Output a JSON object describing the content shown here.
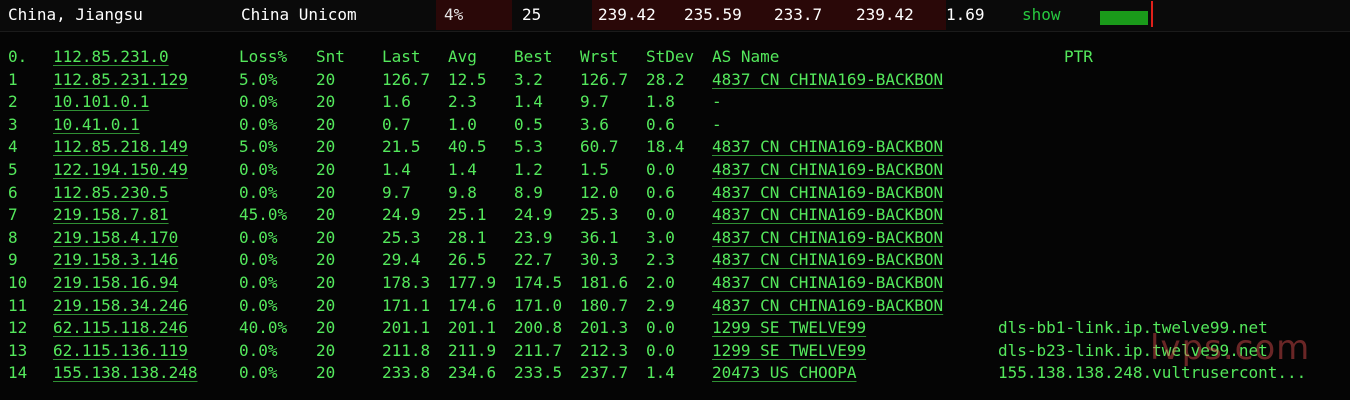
{
  "top": {
    "location": "China, Jiangsu",
    "isp": "China Unicom",
    "loss": "4%",
    "snt": "25",
    "last": "239.42",
    "avg": "235.59",
    "best": "233.7",
    "wrst": "239.42",
    "stdev": "1.69",
    "show_label": "show",
    "bar_fill_fraction": 0.78,
    "bar_color": "#1a9a1a",
    "marker_color": "#e0201a"
  },
  "columns": {
    "hop": "0.",
    "host": "112.85.231.0",
    "loss": "Loss%",
    "snt": "Snt",
    "last": "Last",
    "avg": "Avg",
    "best": "Best",
    "wrst": "Wrst",
    "stdev": "StDev",
    "as": "AS Name",
    "ptr": "PTR"
  },
  "rows": [
    {
      "hop": "1",
      "host": "112.85.231.129",
      "loss": "5.0%",
      "snt": "20",
      "last": "126.7",
      "avg": "12.5",
      "best": "3.2",
      "wrst": "126.7",
      "stdev": "28.2",
      "as": "4837  CN CHINA169-BACKBON",
      "ptr": ""
    },
    {
      "hop": "2",
      "host": "10.101.0.1",
      "loss": "0.0%",
      "snt": "20",
      "last": "1.6",
      "avg": "2.3",
      "best": "1.4",
      "wrst": "9.7",
      "stdev": "1.8",
      "as": "-",
      "ptr": ""
    },
    {
      "hop": "3",
      "host": "10.41.0.1",
      "loss": "0.0%",
      "snt": "20",
      "last": "0.7",
      "avg": "1.0",
      "best": "0.5",
      "wrst": "3.6",
      "stdev": "0.6",
      "as": "-",
      "ptr": ""
    },
    {
      "hop": "4",
      "host": "112.85.218.149",
      "loss": "5.0%",
      "snt": "20",
      "last": "21.5",
      "avg": "40.5",
      "best": "5.3",
      "wrst": "60.7",
      "stdev": "18.4",
      "as": "4837  CN CHINA169-BACKBON",
      "ptr": ""
    },
    {
      "hop": "5",
      "host": "122.194.150.49",
      "loss": "0.0%",
      "snt": "20",
      "last": "1.4",
      "avg": "1.4",
      "best": "1.2",
      "wrst": "1.5",
      "stdev": "0.0",
      "as": "4837  CN CHINA169-BACKBON",
      "ptr": ""
    },
    {
      "hop": "6",
      "host": "112.85.230.5",
      "loss": "0.0%",
      "snt": "20",
      "last": "9.7",
      "avg": "9.8",
      "best": "8.9",
      "wrst": "12.0",
      "stdev": "0.6",
      "as": "4837  CN CHINA169-BACKBON",
      "ptr": ""
    },
    {
      "hop": "7",
      "host": "219.158.7.81",
      "loss": "45.0%",
      "snt": "20",
      "last": "24.9",
      "avg": "25.1",
      "best": "24.9",
      "wrst": "25.3",
      "stdev": "0.0",
      "as": "4837  CN CHINA169-BACKBON",
      "ptr": ""
    },
    {
      "hop": "8",
      "host": "219.158.4.170",
      "loss": "0.0%",
      "snt": "20",
      "last": "25.3",
      "avg": "28.1",
      "best": "23.9",
      "wrst": "36.1",
      "stdev": "3.0",
      "as": "4837  CN CHINA169-BACKBON",
      "ptr": ""
    },
    {
      "hop": "9",
      "host": "219.158.3.146",
      "loss": "0.0%",
      "snt": "20",
      "last": "29.4",
      "avg": "26.5",
      "best": "22.7",
      "wrst": "30.3",
      "stdev": "2.3",
      "as": "4837  CN CHINA169-BACKBON",
      "ptr": ""
    },
    {
      "hop": "10",
      "host": "219.158.16.94",
      "loss": "0.0%",
      "snt": "20",
      "last": "178.3",
      "avg": "177.9",
      "best": "174.5",
      "wrst": "181.6",
      "stdev": "2.0",
      "as": "4837  CN CHINA169-BACKBON",
      "ptr": ""
    },
    {
      "hop": "11",
      "host": "219.158.34.246",
      "loss": "0.0%",
      "snt": "20",
      "last": "171.1",
      "avg": "174.6",
      "best": "171.0",
      "wrst": "180.7",
      "stdev": "2.9",
      "as": "4837  CN CHINA169-BACKBON",
      "ptr": ""
    },
    {
      "hop": "12",
      "host": "62.115.118.246",
      "loss": "40.0%",
      "snt": "20",
      "last": "201.1",
      "avg": "201.1",
      "best": "200.8",
      "wrst": "201.3",
      "stdev": "0.0",
      "as": "1299  SE TWELVE99",
      "ptr": "dls-bb1-link.ip.twelve99.net"
    },
    {
      "hop": "13",
      "host": "62.115.136.119",
      "loss": "0.0%",
      "snt": "20",
      "last": "211.8",
      "avg": "211.9",
      "best": "211.7",
      "wrst": "212.3",
      "stdev": "0.0",
      "as": "1299  SE TWELVE99",
      "ptr": "dls-b23-link.ip.twelve99.net"
    },
    {
      "hop": "14",
      "host": "155.138.138.248",
      "loss": "0.0%",
      "snt": "20",
      "last": "233.8",
      "avg": "234.6",
      "best": "233.5",
      "wrst": "237.7",
      "stdev": "1.4",
      "as": "20473 US CHOOPA",
      "ptr": "155.138.138.248.vultrusercont..."
    }
  ],
  "watermark": "lvps.com"
}
